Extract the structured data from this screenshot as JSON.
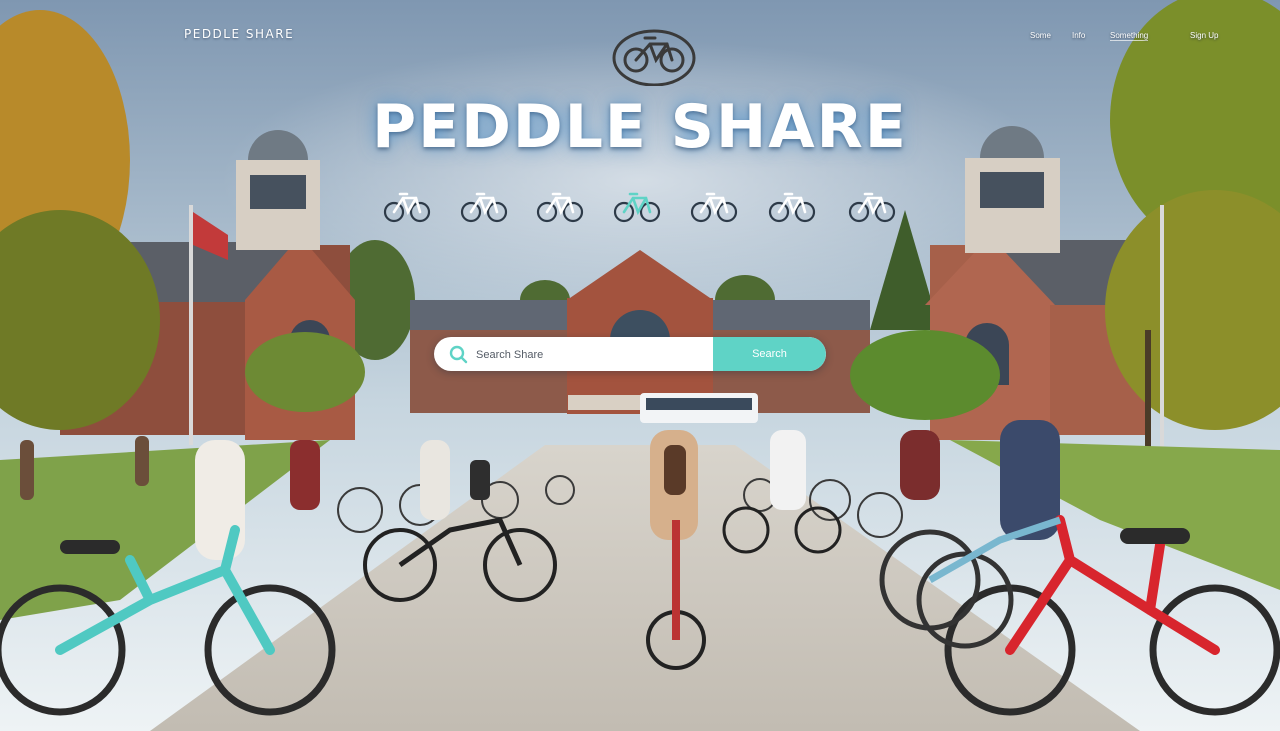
{
  "brand": {
    "small_title": "PEDDLE SHARE",
    "hero_title": "PEDDLE SHARE"
  },
  "nav": {
    "items": [
      "Some",
      "Info",
      "Something",
      "Sign Up"
    ]
  },
  "search": {
    "placeholder": "Search Share",
    "button_label": "Search"
  },
  "bike_icons": [
    {
      "name": "bike-icon",
      "color": "#ffffff"
    },
    {
      "name": "bike-icon",
      "color": "#ffffff"
    },
    {
      "name": "bike-icon",
      "color": "#ffffff"
    },
    {
      "name": "bike-icon",
      "color": "#5fd3c6"
    },
    {
      "name": "bike-icon",
      "color": "#ffffff"
    },
    {
      "name": "bike-icon",
      "color": "#ffffff"
    },
    {
      "name": "bike-icon",
      "color": "#ffffff"
    }
  ],
  "colors": {
    "accent": "#5fd3c6",
    "sky_top": "#7f97b1",
    "sky_bottom": "#eef3f5",
    "brick": "#a65a44",
    "bike_teal": "#4fc9c2",
    "bike_red": "#d8252d"
  }
}
